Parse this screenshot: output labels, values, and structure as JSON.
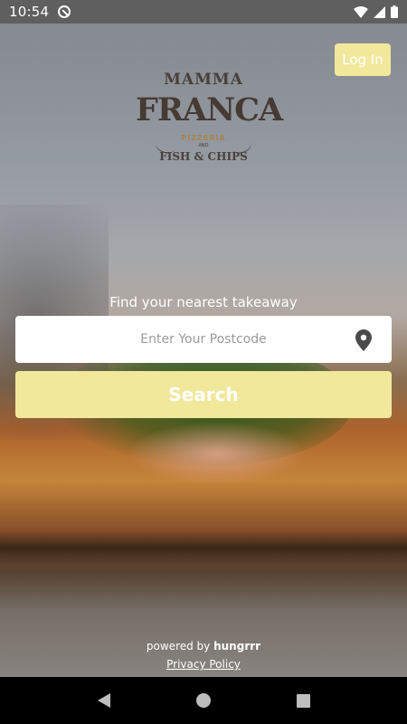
{
  "status_bar": {
    "time": "10:54",
    "icons": [
      "at-sign-icon",
      "wifi-icon",
      "signal-icon",
      "battery-icon"
    ]
  },
  "header": {
    "login_label": "Log In"
  },
  "logo": {
    "top": "MAMMA",
    "main": "FRANCA",
    "sub1": "PIZZERIA",
    "sub2": "AND",
    "sub3": "FISH & CHIPS"
  },
  "search": {
    "label": "Find your nearest takeaway",
    "placeholder": "Enter Your Postcode",
    "value": "",
    "button_label": "Search",
    "pin_icon": "location-pin-icon"
  },
  "footer": {
    "powered_prefix": "powered by",
    "powered_brand": "hungrrr",
    "privacy_label": "Privacy Policy"
  },
  "colors": {
    "accent": "#f1e89c",
    "status_bar": "#5f5f5f",
    "nav_bar": "#000000"
  }
}
